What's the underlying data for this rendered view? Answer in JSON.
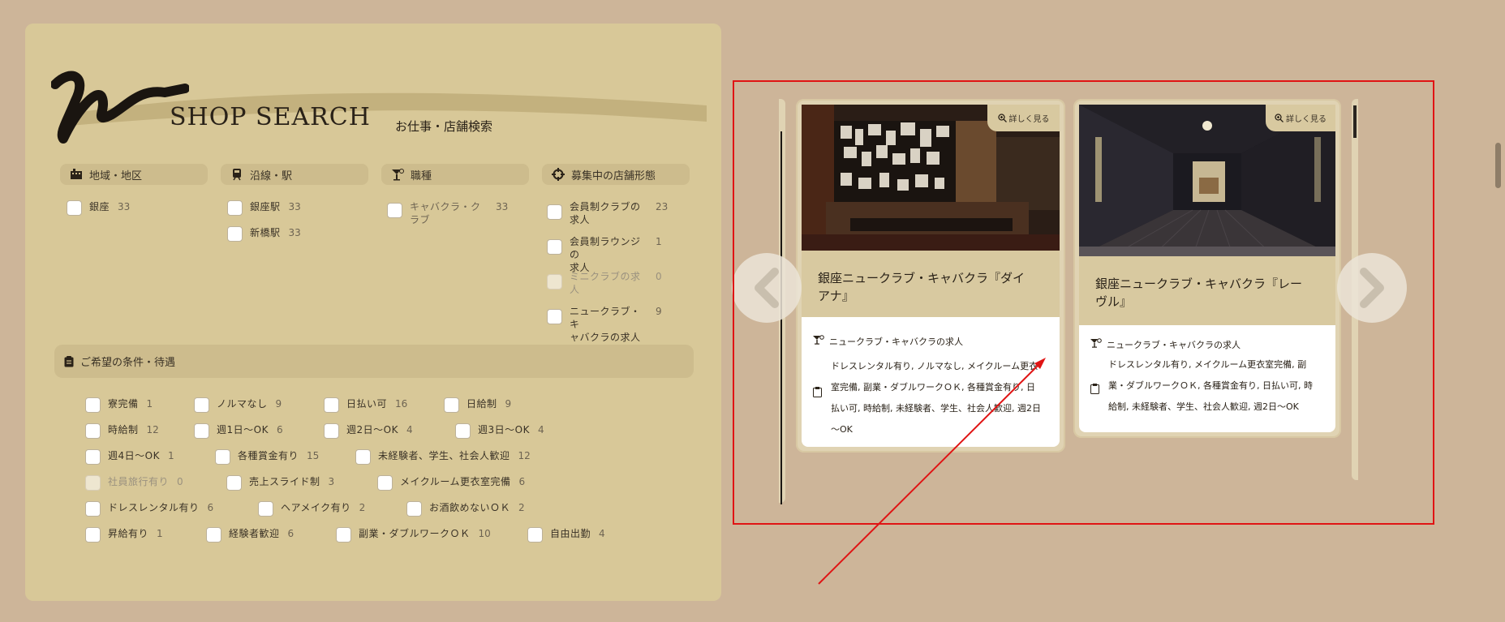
{
  "header": {
    "title": "SHOP SEARCH",
    "subtitle": "お仕事・店舗検索"
  },
  "categories": {
    "area": {
      "label": "地域・地区",
      "icon": "building-icon",
      "items": [
        {
          "label": "銀座",
          "count": "33"
        }
      ]
    },
    "line": {
      "label": "沿線・駅",
      "icon": "train-icon",
      "items": [
        {
          "label": "銀座駅",
          "count": "33"
        },
        {
          "label": "新橋駅",
          "count": "33"
        }
      ]
    },
    "job": {
      "label": "職種",
      "icon": "cocktail-icon",
      "items": [
        {
          "label": "キャバクラ・ク",
          "label2": "ラブ",
          "count": "33"
        }
      ]
    },
    "shop_type": {
      "label": "募集中の店舗形態",
      "icon": "crosshair-icon",
      "items": [
        {
          "label": "会員制クラブの",
          "label2": "求人",
          "count": "23"
        },
        {
          "label": "会員制ラウンジの",
          "label2": "求人",
          "count": "1"
        },
        {
          "label": "ミニクラブの求",
          "label2": "人",
          "count": "0"
        },
        {
          "label": "ニュークラブ・キ",
          "label2": "ャバクラの求人",
          "count": "9"
        }
      ]
    }
  },
  "conditions": {
    "label": "ご希望の条件・待遇",
    "rows": [
      [
        {
          "label": "寮完備",
          "count": "1"
        },
        {
          "label": "ノルマなし",
          "count": "9"
        },
        {
          "label": "日払い可",
          "count": "16"
        },
        {
          "label": "日給制",
          "count": "9"
        }
      ],
      [
        {
          "label": "時給制",
          "count": "12"
        },
        {
          "label": "週1日～OK",
          "count": "6"
        },
        {
          "label": "週2日～OK",
          "count": "4"
        },
        {
          "label": "週3日～OK",
          "count": "4"
        }
      ],
      [
        {
          "label": "週4日～OK",
          "count": "1"
        },
        {
          "label": "各種賞金有り",
          "count": "15"
        },
        {
          "label": "未経験者、学生、社会人歓迎",
          "count": "12"
        }
      ],
      [
        {
          "label": "社員旅行有り",
          "count": "0"
        },
        {
          "label": "売上スライド制",
          "count": "3"
        },
        {
          "label": "メイクルーム更衣室完備",
          "count": "6"
        }
      ],
      [
        {
          "label": "ドレスレンタル有り",
          "count": "6"
        },
        {
          "label": "ヘアメイク有り",
          "count": "2"
        },
        {
          "label": "お酒飲めないＯＫ",
          "count": "2"
        }
      ],
      [
        {
          "label": "昇給有り",
          "count": "1"
        },
        {
          "label": "経験者歓迎",
          "count": "6"
        },
        {
          "label": "副業・ダブルワークＯＫ",
          "count": "10"
        },
        {
          "label": "自由出勤",
          "count": "4"
        }
      ]
    ]
  },
  "cards": [
    {
      "detail_label": "詳しく見る",
      "title_line1": "銀座ニュークラブ・キャバクラ『ダイ",
      "title_line2": "アナ』",
      "job_type": "ニュークラブ・キャバクラの求人",
      "conditions_lines": [
        "ドレスレンタル有り, ノルマなし, メイクルーム更衣",
        "室完備, 副業・ダブルワークＯＫ, 各種賞金有り, 日",
        "払い可, 時給制, 未経験者、学生、社会人歓迎, 週2日",
        "～OK"
      ]
    },
    {
      "detail_label": "詳しく見る",
      "title_line1": "銀座ニュークラブ・キャバクラ『レー",
      "title_line2": "ヴル』",
      "job_type": "ニュークラブ・キャバクラの求人",
      "conditions_lines": [
        "ドレスレンタル有り, メイクルーム更衣室完備, 副",
        "業・ダブルワークＯＫ, 各種賞金有り, 日払い可, 時",
        "給制, 未経験者、学生、社会人歓迎, 週2日～OK"
      ]
    }
  ],
  "colors": {
    "page_bg": "#cdb599",
    "panel_bg": "#d8c898",
    "highlight_box": "#e01414"
  }
}
